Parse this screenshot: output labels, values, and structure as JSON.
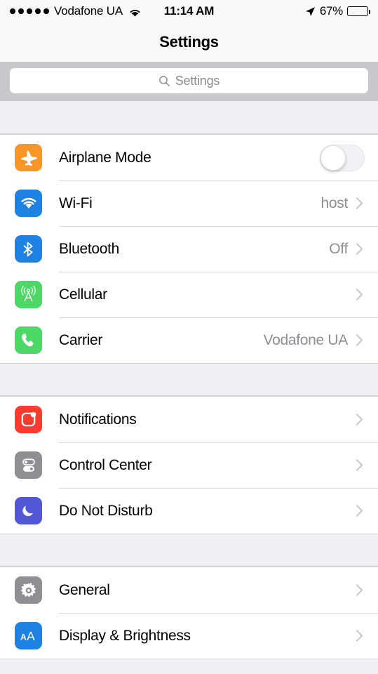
{
  "status_bar": {
    "signal_dots": 5,
    "carrier": "Vodafone UA",
    "wifi_icon": "wifi-icon",
    "time": "11:14 AM",
    "location_icon": "location-arrow-icon",
    "battery_percent": "67%",
    "battery_level": 67
  },
  "nav": {
    "title": "Settings"
  },
  "search": {
    "placeholder": "Settings",
    "value": "",
    "icon": "search-icon"
  },
  "groups": [
    {
      "rows": [
        {
          "label": "Airplane Mode",
          "icon": "airplane-icon",
          "icon_color": "#f79626",
          "control": "toggle",
          "toggle_on": false,
          "value": "",
          "chevron": false
        },
        {
          "label": "Wi-Fi",
          "icon": "wifi-icon",
          "icon_color": "#1d82e2",
          "control": "disclosure",
          "value": "host",
          "chevron": true
        },
        {
          "label": "Bluetooth",
          "icon": "bluetooth-icon",
          "icon_color": "#1d82e2",
          "control": "disclosure",
          "value": "Off",
          "chevron": true
        },
        {
          "label": "Cellular",
          "icon": "cellular-antenna-icon",
          "icon_color": "#4cd864",
          "control": "disclosure",
          "value": "",
          "chevron": true
        },
        {
          "label": "Carrier",
          "icon": "phone-icon",
          "icon_color": "#4cd864",
          "control": "disclosure",
          "value": "Vodafone UA",
          "chevron": true
        }
      ]
    },
    {
      "rows": [
        {
          "label": "Notifications",
          "icon": "notifications-badge-icon",
          "icon_color": "#fc3a2e",
          "control": "disclosure",
          "value": "",
          "chevron": true
        },
        {
          "label": "Control Center",
          "icon": "control-center-toggles-icon",
          "icon_color": "#8e8e93",
          "control": "disclosure",
          "value": "",
          "chevron": true
        },
        {
          "label": "Do Not Disturb",
          "icon": "moon-icon",
          "icon_color": "#5257d6",
          "control": "disclosure",
          "value": "",
          "chevron": true
        }
      ]
    },
    {
      "rows": [
        {
          "label": "General",
          "icon": "gear-icon",
          "icon_color": "#8e8e93",
          "control": "disclosure",
          "value": "",
          "chevron": true
        },
        {
          "label": "Display & Brightness",
          "icon": "text-size-aa-icon",
          "icon_color": "#1d82e2",
          "control": "disclosure",
          "value": "",
          "chevron": true
        }
      ]
    }
  ],
  "colors": {
    "separator": "#dcdcdf",
    "group_gap": "#efeff4",
    "search_band": "#c8c7cc",
    "value_text": "#8e8e93",
    "chevron": "#c7c7cc",
    "navbar": "#f8f8f8"
  }
}
